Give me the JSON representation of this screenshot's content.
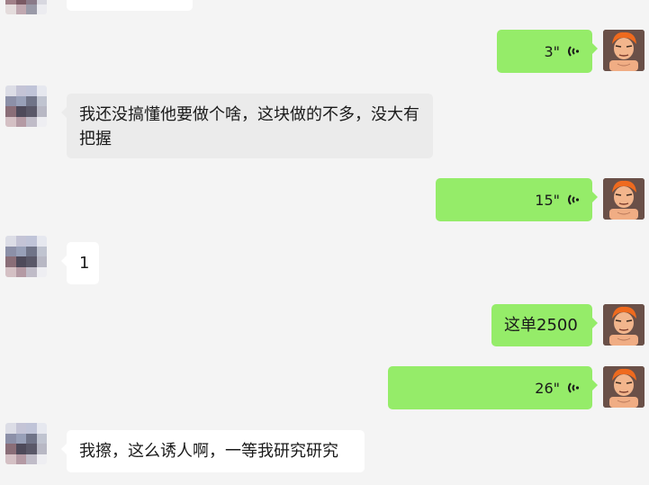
{
  "messages": [
    {
      "side": "in",
      "type": "text",
      "text": ""
    },
    {
      "side": "out",
      "type": "voice",
      "duration": "3\""
    },
    {
      "side": "in",
      "type": "text",
      "text": "我还没搞懂他要做个啥，这块做的不多，没大有把握"
    },
    {
      "side": "out",
      "type": "voice",
      "duration": "15\""
    },
    {
      "side": "in",
      "type": "text",
      "text": "1"
    },
    {
      "side": "out",
      "type": "text",
      "text": "这单2500"
    },
    {
      "side": "out",
      "type": "voice",
      "duration": "26\""
    },
    {
      "side": "in",
      "type": "text",
      "text": "我擦，这么诱人啊，一等我研究研究"
    }
  ],
  "icons": {
    "voice": "voice-wave-icon",
    "self_avatar": "cartoon-avatar-icon",
    "contact_avatar": "pixelated-avatar"
  },
  "colors": {
    "background": "#f4f4f4",
    "outgoing_bubble": "#95ec69",
    "incoming_bubble": "#ffffff",
    "incoming_bubble_alt": "#ebebeb"
  }
}
